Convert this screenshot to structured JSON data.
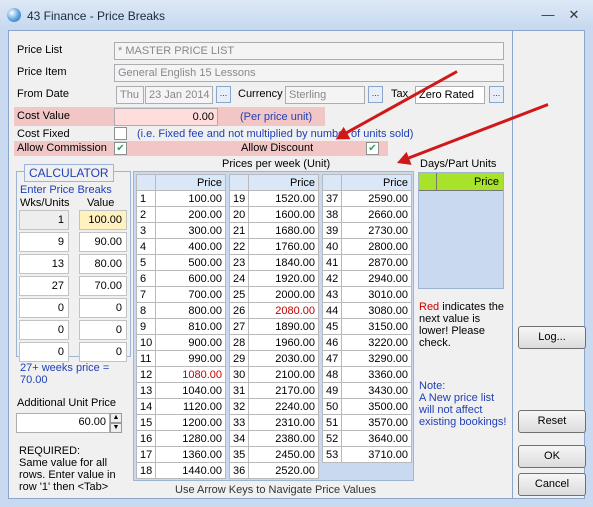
{
  "window": {
    "title": "43 Finance - Price Breaks",
    "minimize": "—",
    "close": "✕"
  },
  "form": {
    "price_list_label": "Price List",
    "price_list_value": "* MASTER PRICE LIST",
    "price_item_label": "Price Item",
    "price_item_value": "General English 15 Lessons",
    "from_date_label": "From Date",
    "from_day": "Thu",
    "from_date": "23 Jan 2014",
    "currency_label": "Currency",
    "currency_value": "Sterling",
    "tax_label": "Tax",
    "tax_value": "Zero Rated",
    "ellipsis": "...",
    "cost_value_label": "Cost Value",
    "cost_value": "0.00",
    "per_price_unit": "(Per price unit)",
    "cost_fixed_label": "Cost Fixed",
    "cost_fixed_note": "(i.e. Fixed fee and not multiplied by number of units sold)",
    "allow_commission_label": "Allow Commission",
    "allow_discount_label": "Allow Discount",
    "check": "✔"
  },
  "calculator": {
    "title": "CALCULATOR",
    "heading": "Enter Price Breaks",
    "col_wks": "Wks/Units",
    "col_value": "Value",
    "rows": [
      {
        "wks": "1",
        "value": "100.00"
      },
      {
        "wks": "9",
        "value": "90.00"
      },
      {
        "wks": "13",
        "value": "80.00"
      },
      {
        "wks": "27",
        "value": "70.00"
      },
      {
        "wks": "0",
        "value": "0"
      },
      {
        "wks": "0",
        "value": "0"
      },
      {
        "wks": "0",
        "value": "0"
      }
    ],
    "summary_line1": "27+ weeks price =",
    "summary_line2": "70.00"
  },
  "additional": {
    "label": "Additional Unit Price",
    "value": "60.00",
    "spin_up": "▲",
    "spin_down": "▼"
  },
  "required": {
    "lines": [
      "REQUIRED:",
      "Same value for all",
      "rows.  Enter value in",
      "row '1' then <Tab>"
    ]
  },
  "prices": {
    "header": "Prices per week (Unit)",
    "col_price": "Price",
    "footer": "Use Arrow Keys to Navigate Price Values",
    "col1": [
      [
        "1",
        "100.00"
      ],
      [
        "2",
        "200.00"
      ],
      [
        "3",
        "300.00"
      ],
      [
        "4",
        "400.00"
      ],
      [
        "5",
        "500.00"
      ],
      [
        "6",
        "600.00"
      ],
      [
        "7",
        "700.00"
      ],
      [
        "8",
        "800.00"
      ],
      [
        "9",
        "810.00"
      ],
      [
        "10",
        "900.00"
      ],
      [
        "11",
        "990.00"
      ],
      [
        "12",
        "1080.00"
      ],
      [
        "13",
        "1040.00"
      ],
      [
        "14",
        "1120.00"
      ],
      [
        "15",
        "1200.00"
      ],
      [
        "16",
        "1280.00"
      ],
      [
        "17",
        "1360.00"
      ],
      [
        "18",
        "1440.00"
      ]
    ],
    "col2": [
      [
        "19",
        "1520.00"
      ],
      [
        "20",
        "1600.00"
      ],
      [
        "21",
        "1680.00"
      ],
      [
        "22",
        "1760.00"
      ],
      [
        "23",
        "1840.00"
      ],
      [
        "24",
        "1920.00"
      ],
      [
        "25",
        "2000.00"
      ],
      [
        "26",
        "2080.00"
      ],
      [
        "27",
        "1890.00"
      ],
      [
        "28",
        "1960.00"
      ],
      [
        "29",
        "2030.00"
      ],
      [
        "30",
        "2100.00"
      ],
      [
        "31",
        "2170.00"
      ],
      [
        "32",
        "2240.00"
      ],
      [
        "33",
        "2310.00"
      ],
      [
        "34",
        "2380.00"
      ],
      [
        "35",
        "2450.00"
      ],
      [
        "36",
        "2520.00"
      ]
    ],
    "col3": [
      [
        "37",
        "2590.00"
      ],
      [
        "38",
        "2660.00"
      ],
      [
        "39",
        "2730.00"
      ],
      [
        "40",
        "2800.00"
      ],
      [
        "41",
        "2870.00"
      ],
      [
        "42",
        "2940.00"
      ],
      [
        "43",
        "3010.00"
      ],
      [
        "44",
        "3080.00"
      ],
      [
        "45",
        "3150.00"
      ],
      [
        "46",
        "3220.00"
      ],
      [
        "47",
        "3290.00"
      ],
      [
        "48",
        "3360.00"
      ],
      [
        "49",
        "3430.00"
      ],
      [
        "50",
        "3500.00"
      ],
      [
        "51",
        "3570.00"
      ],
      [
        "52",
        "3640.00"
      ],
      [
        "53",
        "3710.00"
      ]
    ],
    "red_cells": [
      "12",
      "26"
    ]
  },
  "days": {
    "header": "Days/Part Units",
    "col_price": "Price",
    "red_word": "Red",
    "red_note": "indicates the next value is lower!  Please check.",
    "note_title": "Note:",
    "note_text": "A New price list will not affect existing bookings!"
  },
  "buttons": {
    "log": "Log...",
    "reset": "Reset",
    "ok": "OK",
    "cancel": "Cancel"
  },
  "colors": {
    "highlight_pink": "#f3c6c6",
    "arrow_red": "#d01818",
    "days_header_green": "#a8e22a",
    "warning_red": "#c00000",
    "info_blue": "#1f3fb6"
  }
}
